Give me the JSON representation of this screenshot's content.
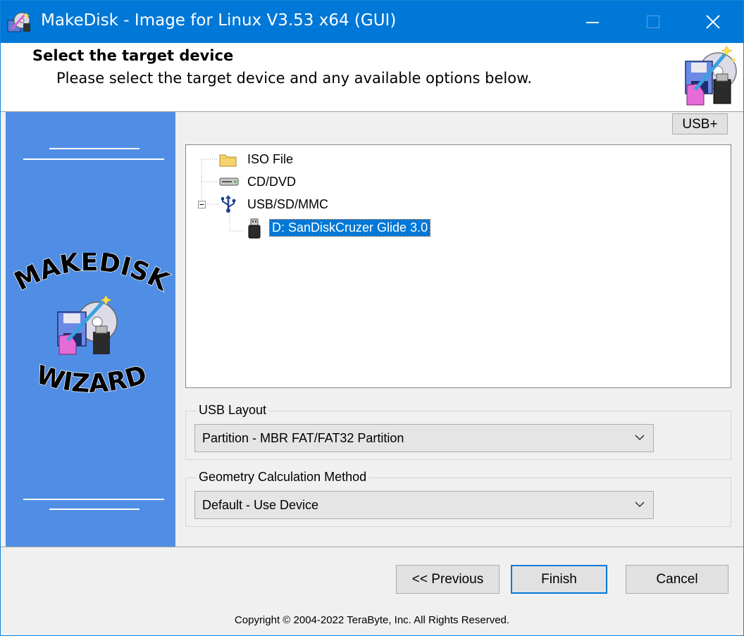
{
  "window": {
    "title": "MakeDisk - Image for Linux V3.53 x64 (GUI)",
    "minimize_icon": "minimize-icon",
    "maximize_icon": "maximize-icon",
    "close_icon": "close-icon",
    "accent": "#0078d7"
  },
  "header": {
    "title": "Select the target device",
    "subtitle": "Please select the target device and any available options below."
  },
  "sidebar": {
    "brand_top": "MAKEDISK",
    "brand_bottom": "WIZARD",
    "background": "#4f8ee4"
  },
  "toolbar": {
    "usb_plus_label": "USB+"
  },
  "device_tree": {
    "items": [
      {
        "label": "ISO File",
        "icon": "folder-icon"
      },
      {
        "label": "CD/DVD",
        "icon": "drive-icon"
      },
      {
        "label": "USB/SD/MMC",
        "icon": "usb-icon",
        "expanded": true
      },
      {
        "label": "D: SanDiskCruzer Glide 3.0",
        "icon": "usb-stick-icon",
        "selected": true
      }
    ]
  },
  "usb_layout": {
    "label": "USB Layout",
    "value": "Partition - MBR FAT/FAT32 Partition"
  },
  "geometry": {
    "label": "Geometry Calculation Method",
    "value": "Default - Use Device"
  },
  "buttons": {
    "previous": "<< Previous",
    "finish": "Finish",
    "cancel": "Cancel"
  },
  "footer": {
    "copyright": "Copyright © 2004-2022 TeraByte, Inc.  All Rights Reserved."
  }
}
